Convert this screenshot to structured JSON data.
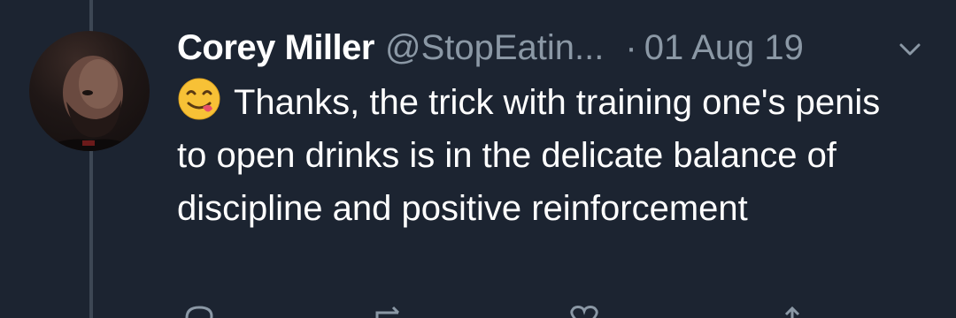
{
  "tweet": {
    "author_name": "Corey Miller",
    "handle": "@StopEatin...",
    "separator": "·",
    "date": "01 Aug 19",
    "text": "Thanks, the trick with training one's penis to open drinks is in the delicate balance of discipline and positive reinforcement",
    "emoji": "face-savoring-food"
  },
  "icons": {
    "menu": "chevron-down-icon",
    "actions": [
      "reply-icon",
      "retweet-icon",
      "like-icon",
      "share-icon"
    ]
  },
  "colors": {
    "background": "#1c2431",
    "text_primary": "#ffffff",
    "text_secondary": "#8b98a5",
    "thread_line": "#3d4754"
  }
}
